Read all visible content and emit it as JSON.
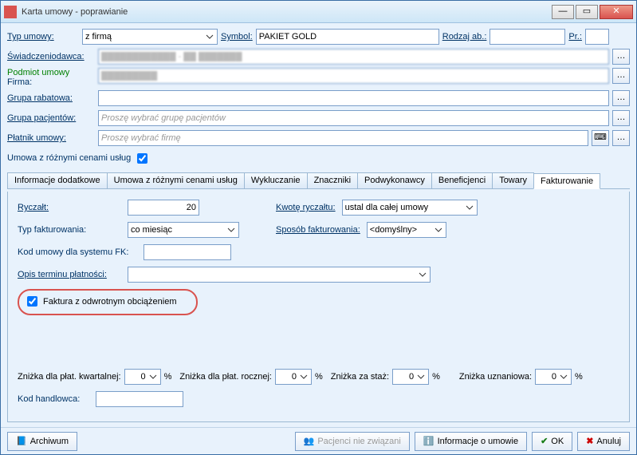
{
  "window": {
    "title": "Karta umowy - poprawianie"
  },
  "header": {
    "typ_label": "Typ umowy:",
    "typ_value": "z firmą",
    "symbol_label": "Symbol:",
    "symbol_value": "PAKIET GOLD",
    "rodzaj_label": "Rodzaj ab.:",
    "rodzaj_value": "",
    "pr_label": "Pr.:",
    "pr_value": "",
    "swiad_label": "Świadczeniodawca:",
    "swiad_value": "████████████ - ██ ███████",
    "podmiot_label": "Podmiot umowy",
    "firma_label": "Firma:",
    "firma_value": "█████████",
    "grupa_rab_label": "Grupa rabatowa:",
    "grupa_rab_value": "",
    "grupa_pac_label": "Grupa pacjentów:",
    "grupa_pac_placeholder": "Proszę wybrać grupę pacjentów",
    "platnik_label": "Płatnik umowy:",
    "platnik_placeholder": "Proszę wybrać firmę",
    "rozne_ceny_label": "Umowa z różnymi cenami usług"
  },
  "tabs": {
    "t0": "Informacje dodatkowe",
    "t1": "Umowa z różnymi cenami usług",
    "t2": "Wykluczanie",
    "t3": "Znaczniki",
    "t4": "Podwykonawcy",
    "t5": "Beneficjenci",
    "t6": "Towary",
    "t7": "Fakturowanie"
  },
  "fakt": {
    "ryczalt_label": "Ryczałt:",
    "ryczalt_value": "20",
    "kwote_label": "Kwotę ryczałtu:",
    "kwote_value": "ustal dla całej umowy",
    "typ_fakt_label": "Typ fakturowania:",
    "typ_fakt_value": "co miesiąc",
    "sposob_label": "Sposób fakturowania:",
    "sposob_value": "<domyślny>",
    "kod_fk_label": "Kod umowy dla systemu FK:",
    "kod_fk_value": "",
    "opis_label": "Opis terminu płatności:",
    "opis_value": "",
    "odwrotne_label": "Faktura z odwrotnym obciążeniem",
    "zn_kwart_label": "Zniżka dla płat. kwartalnej:",
    "zn_kwart_value": "0",
    "zn_rocz_label": "Zniżka dla płat. rocznej:",
    "zn_rocz_value": "0",
    "zn_staz_label": "Zniżka za staż:",
    "zn_staz_value": "0",
    "zn_uzn_label": "Zniżka uznaniowa:",
    "zn_uzn_value": "0",
    "percent": "%",
    "kod_handl_label": "Kod handlowca:",
    "kod_handl_value": ""
  },
  "footer": {
    "archiwum": "Archiwum",
    "pacjenci": "Pacjenci nie związani",
    "info": "Informacje o umowie",
    "ok": "OK",
    "anuluj": "Anuluj"
  }
}
